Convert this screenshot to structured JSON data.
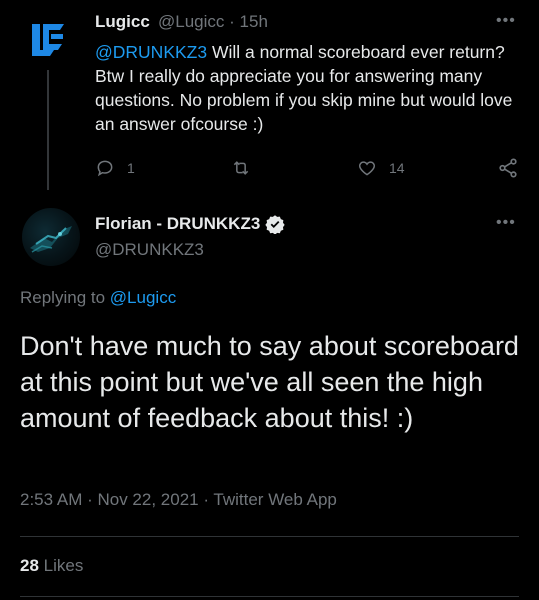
{
  "parent_tweet": {
    "avatar_icon": "lc-logo-icon",
    "display_name": "Lugicc",
    "handle": "@Lugicc",
    "separator": "·",
    "time": "15h",
    "mention": "@DRUNKKZ3",
    "text": " Will a normal scoreboard ever return? Btw I really do appreciate you for answering many questions. No problem if you skip mine but would love an answer ofcourse :)",
    "replies": "1",
    "retweets": "",
    "likes": "14",
    "more_icon": "more-dots-icon"
  },
  "main_tweet": {
    "display_name": "Florian - DRUNKKZ3",
    "verified_icon": "verified-badge-icon",
    "handle": "@DRUNKKZ3",
    "replying_to_label": "Replying to",
    "replying_to_handle": "@Lugicc",
    "text": "Don't have much to say about scoreboard at this point but we've all seen the high amount of feedback about this! :)",
    "timestamp": "2:53 AM · Nov 22, 2021 · Twitter Web App",
    "likes_count": "28",
    "likes_label": "Likes"
  },
  "colors": {
    "background": "#000000",
    "text": "#e7e9ea",
    "secondary": "#71767b",
    "accent": "#1d9bf0",
    "logo_blue": "#1e88e5"
  }
}
